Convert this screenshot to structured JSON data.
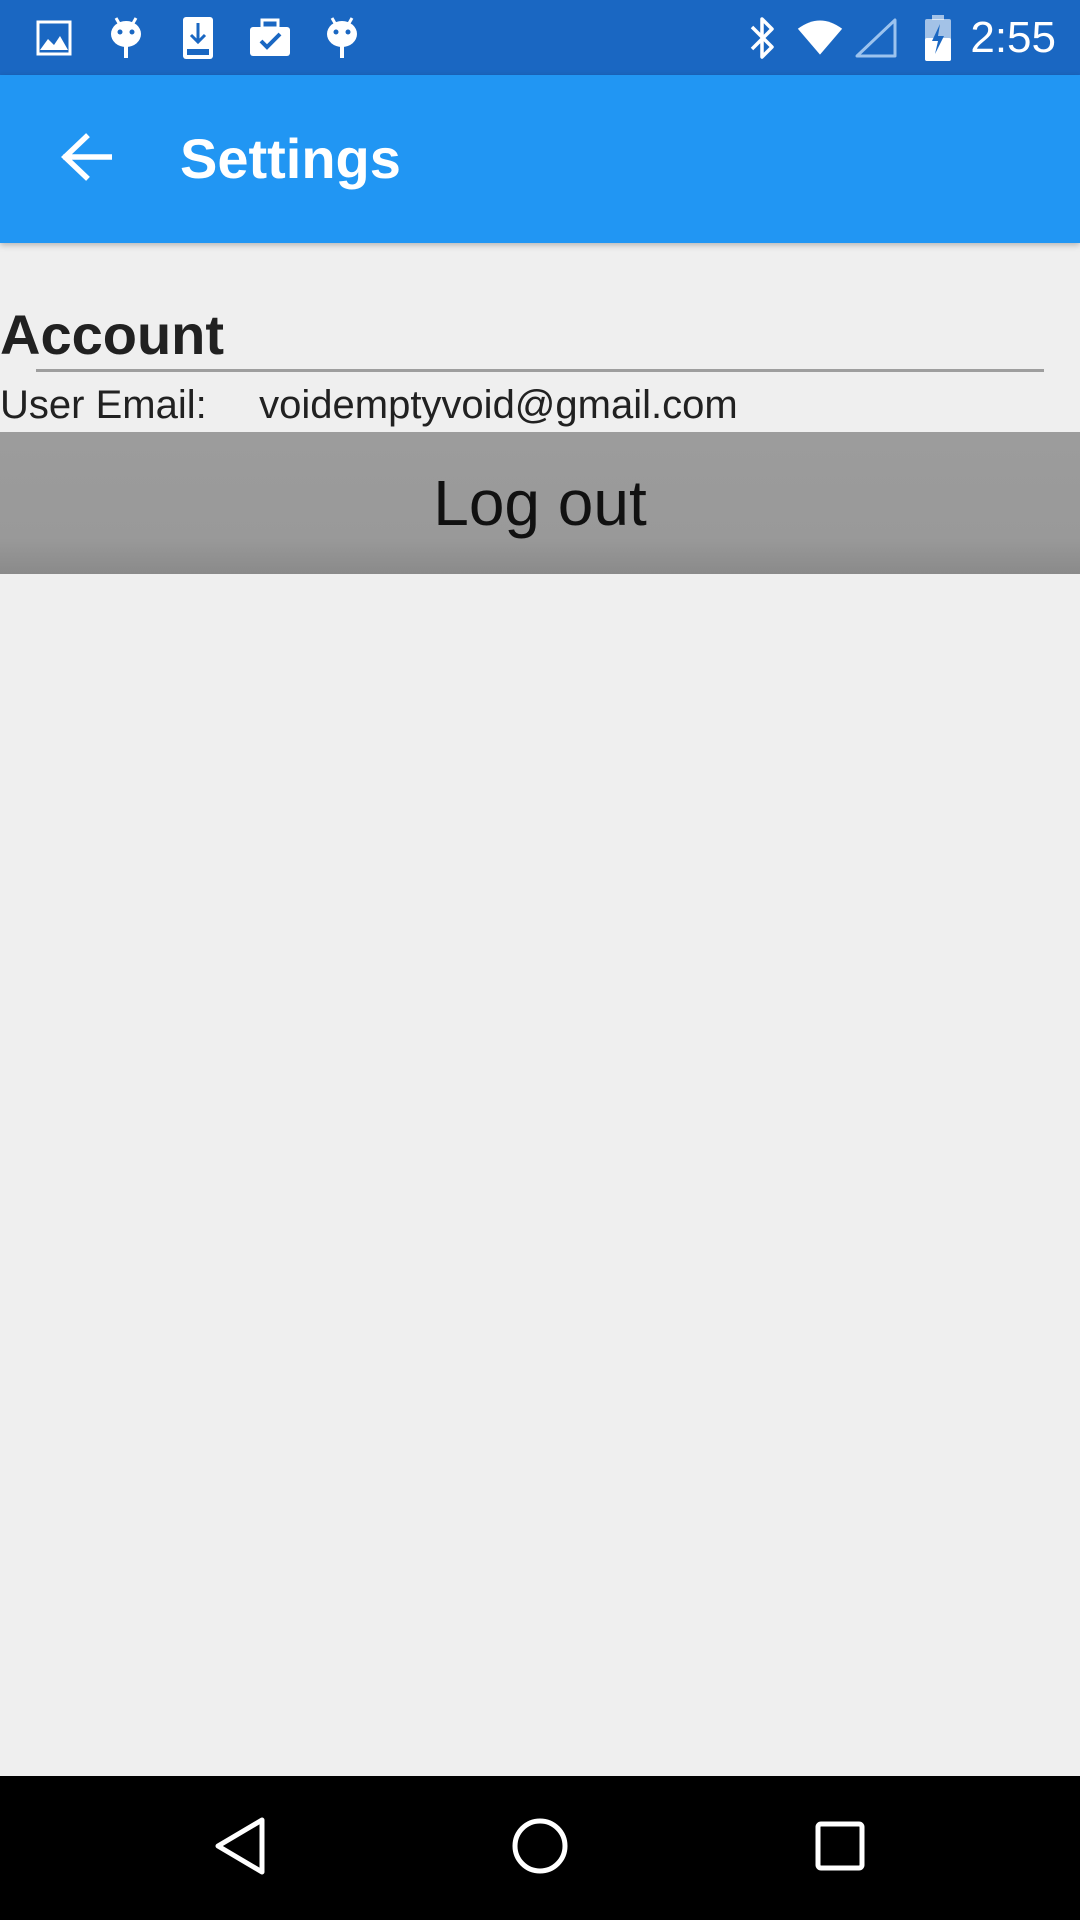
{
  "status_bar": {
    "time": "2:55",
    "notification_icons": [
      "image-icon",
      "android-icon",
      "download-icon",
      "briefcase-check-icon",
      "android-icon"
    ],
    "system_icons": [
      "bluetooth-icon",
      "wifi-icon",
      "cellular-signal-icon",
      "battery-charging-icon"
    ],
    "background_color": "#1a67c2"
  },
  "app_bar": {
    "title": "Settings",
    "back_icon": "arrow-left-icon",
    "background_color": "#2196f3"
  },
  "account": {
    "section_title": "Account",
    "email_label": "User Email:",
    "email_value": "voidemptyvoid@gmail.com",
    "logout_label": "Log out"
  },
  "nav_bar": {
    "buttons": [
      "back-triangle-icon",
      "home-circle-icon",
      "recents-square-icon"
    ]
  }
}
